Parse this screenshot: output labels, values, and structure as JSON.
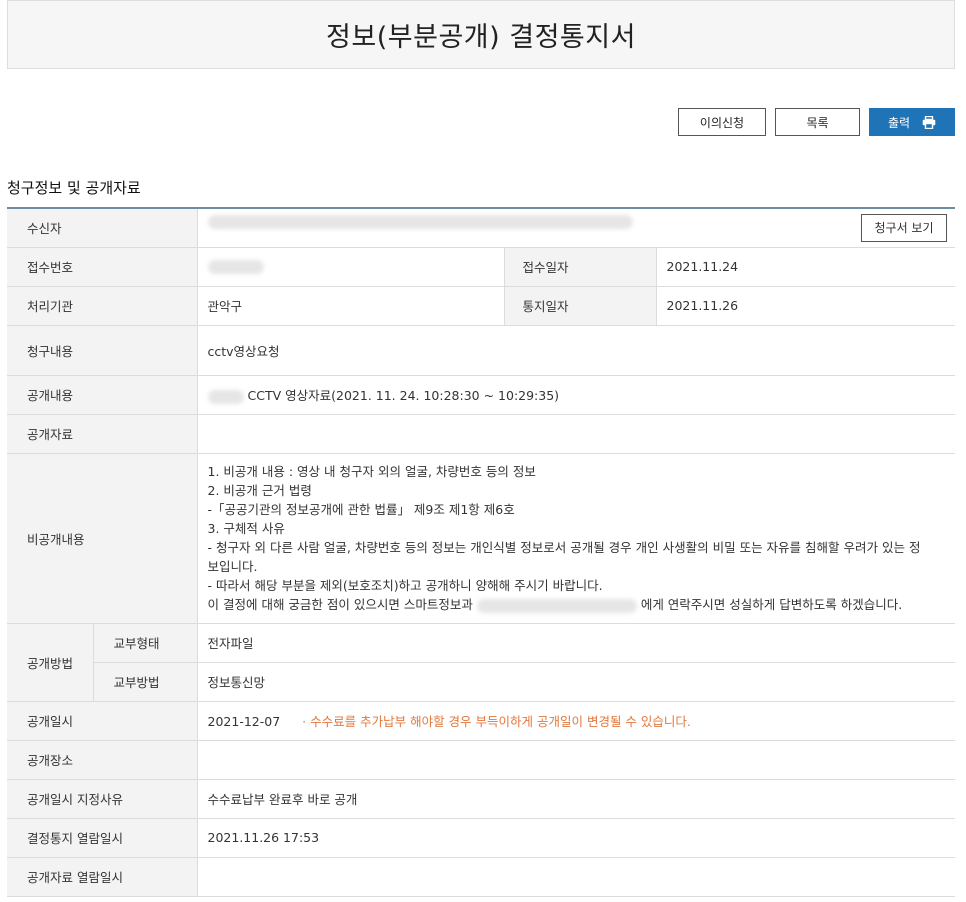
{
  "header": {
    "title": "정보(부분공개) 결정통지서"
  },
  "buttons": {
    "objection": "이의신청",
    "list": "목록",
    "print": "출력"
  },
  "section_title": "청구정보 및 공개자료",
  "view_request_button": "청구서 보기",
  "rows": {
    "recipient": {
      "label": "수신자",
      "value": ""
    },
    "receipt_no": {
      "label": "접수번호",
      "value": ""
    },
    "receipt_date": {
      "label": "접수일자",
      "value": "2021.11.24"
    },
    "agency": {
      "label": "처리기관",
      "value": "관악구"
    },
    "notice_date": {
      "label": "통지일자",
      "value": "2021.11.26"
    },
    "request_content": {
      "label": "청구내용",
      "value": "cctv영상요청"
    },
    "disclosure_content": {
      "label": "공개내용",
      "value": "CCTV 영상자료(2021. 11. 24. 10:28:30 ~ 10:29:35)"
    },
    "disclosure_material": {
      "label": "공개자료",
      "value": ""
    },
    "nondisclosure": {
      "label": "비공개내용",
      "lines": [
        "1. 비공개 내용 : 영상 내 청구자 외의 얼굴, 차량번호 등의 정보",
        "2. 비공개 근거 법령",
        "-「공공기관의 정보공개에 관한 법률」 제9조 제1항 제6호",
        "3. 구체적 사유",
        "- 청구자 외 다른 사람 얼굴, 차량번호 등의 정보는 개인식별 정보로서 공개될 경우 개인 사생활의 비밀 또는 자유를 침해할 우려가 있는 정",
        "보입니다.",
        "- 따라서 해당 부분을 제외(보호조치)하고 공개하니 양해해 주시기 바랍니다."
      ],
      "last_line_prefix": "이 결정에 대해 궁금한 점이 있으시면 스마트정보과",
      "last_line_suffix": "에게 연락주시면 성실하게 답변하도록 하겠습니다."
    },
    "method": {
      "label": "공개방법",
      "delivery_type_label": "교부형태",
      "delivery_type_value": "전자파일",
      "delivery_method_label": "교부방법",
      "delivery_method_value": "정보통신망"
    },
    "disclosure_datetime": {
      "label": "공개일시",
      "value": "2021-12-07",
      "note": "· 수수료를 추가납부 해야할 경우 부득이하게 공개일이 변경될 수 있습니다."
    },
    "disclosure_place": {
      "label": "공개장소",
      "value": ""
    },
    "datetime_reason": {
      "label": "공개일시 지정사유",
      "value": "수수료납부 완료후 바로 공개"
    },
    "decision_viewed": {
      "label": "결정통지 열람일시",
      "value": "2021.11.26 17:53"
    },
    "material_viewed": {
      "label": "공개자료 열람일시",
      "value": ""
    }
  },
  "colors": {
    "accent": "#1f74b7",
    "note": "#e3783c",
    "header_line": "#6e8da3"
  },
  "icons": {
    "print": "printer-icon"
  }
}
